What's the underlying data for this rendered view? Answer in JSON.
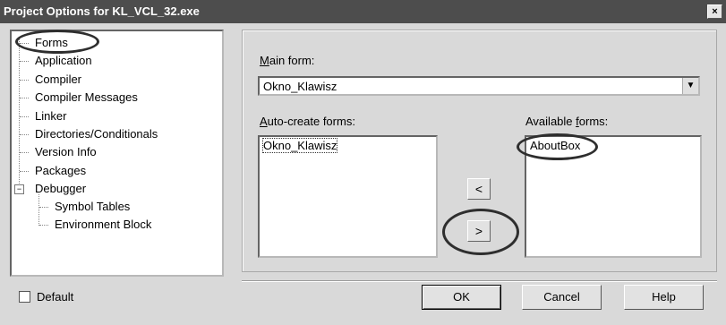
{
  "window": {
    "title": "Project Options for KL_VCL_32.exe",
    "close_glyph": "×"
  },
  "tree": {
    "items": [
      {
        "label": "Forms"
      },
      {
        "label": "Application"
      },
      {
        "label": "Compiler"
      },
      {
        "label": "Compiler Messages"
      },
      {
        "label": "Linker"
      },
      {
        "label": "Directories/Conditionals"
      },
      {
        "label": "Version Info"
      },
      {
        "label": "Packages"
      },
      {
        "label": "Debugger"
      },
      {
        "label": "Symbol Tables"
      },
      {
        "label": "Environment Block"
      }
    ],
    "debugger_expander": "−"
  },
  "main_form": {
    "label_prefix": "M",
    "label_rest": "ain form:",
    "value": "Okno_Klawisz",
    "arrow": "▼"
  },
  "auto_create": {
    "label_prefix": "A",
    "label_rest": "uto-create forms:",
    "items": [
      "Okno_Klawisz"
    ]
  },
  "available": {
    "label_start": "Available ",
    "label_prefix": "f",
    "label_rest": "orms:",
    "items": [
      "AboutBox"
    ]
  },
  "move_buttons": {
    "left": "<",
    "right": ">"
  },
  "default_checkbox": {
    "label": "Default"
  },
  "buttons": {
    "ok": "OK",
    "cancel": "Cancel",
    "help": "Help"
  }
}
